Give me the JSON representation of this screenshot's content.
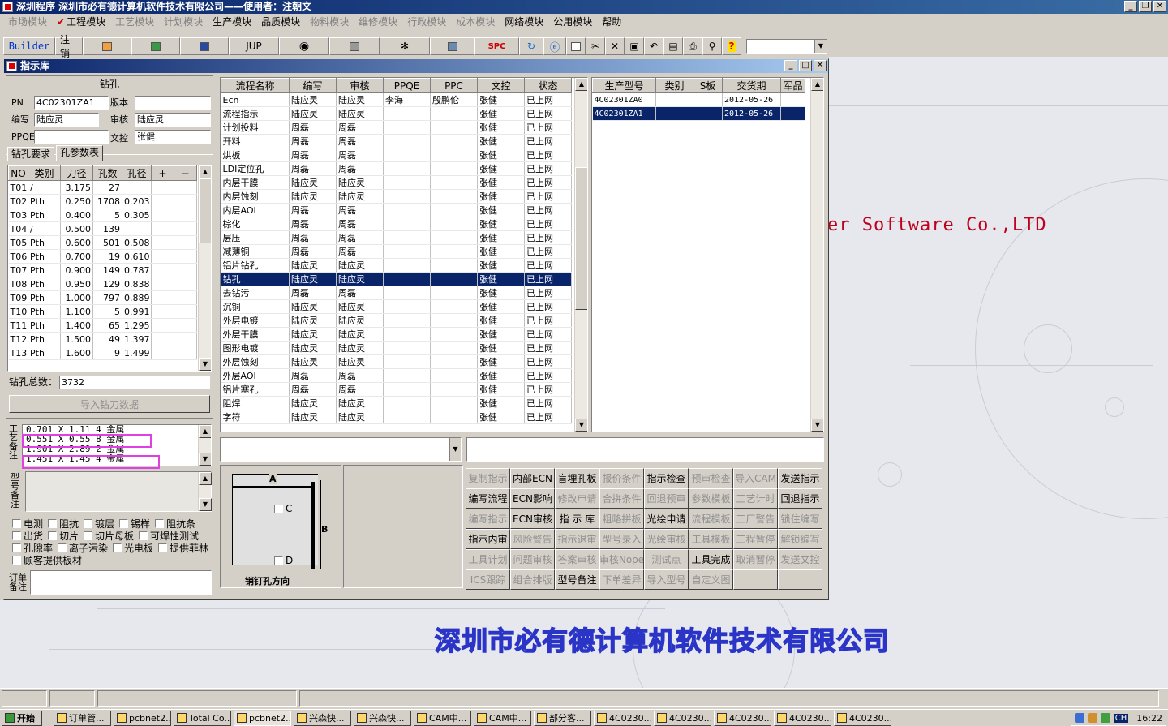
{
  "app": {
    "title": "深圳程序    深圳市必有德计算机软件技术有限公司——使用者：注朝文"
  },
  "menu": [
    {
      "label": "市场模块",
      "enabled": false
    },
    {
      "label": "工程模块",
      "enabled": true,
      "checked": true
    },
    {
      "label": "工艺模块",
      "enabled": false
    },
    {
      "label": "计划模块",
      "enabled": false
    },
    {
      "label": "生产模块",
      "enabled": true
    },
    {
      "label": "品质模块",
      "enabled": true
    },
    {
      "label": "物料模块",
      "enabled": false
    },
    {
      "label": "维修模块",
      "enabled": false
    },
    {
      "label": "行政模块",
      "enabled": false
    },
    {
      "label": "成本模块",
      "enabled": false
    },
    {
      "label": "网络模块",
      "enabled": true
    },
    {
      "label": "公用模块",
      "enabled": true
    },
    {
      "label": "帮助",
      "enabled": true
    }
  ],
  "toolbar": {
    "builder": "Builder",
    "logout": "注销",
    "jup": "JUP",
    "spc": "SPC"
  },
  "window": {
    "title": "指示库"
  },
  "drill": {
    "section_title": "钻孔",
    "pn_label": "PN",
    "pn_value": "4C02301ZA1",
    "version_label": "版本",
    "version_value": "",
    "writer_label": "编写",
    "writer_value": "陆应灵",
    "reviewer_label": "审核",
    "reviewer_value": "陆应灵",
    "ppqe_label": "PPQE",
    "ppqe_value": "",
    "doc_label": "文控",
    "doc_value": "张健",
    "tabs": [
      "钻孔要求",
      "孔参数表"
    ],
    "columns": [
      "NO",
      "类别",
      "刀径",
      "孔数",
      "孔径",
      "+",
      "−"
    ],
    "rows": [
      [
        "T01",
        "/",
        "3.175",
        "27",
        ""
      ],
      [
        "T02",
        "Pth",
        "0.250",
        "1708",
        "0.203"
      ],
      [
        "T03",
        "Pth",
        "0.400",
        "5",
        "0.305"
      ],
      [
        "T04",
        "/",
        "0.500",
        "139",
        ""
      ],
      [
        "T05",
        "Pth",
        "0.600",
        "501",
        "0.508"
      ],
      [
        "T06",
        "Pth",
        "0.700",
        "19",
        "0.610"
      ],
      [
        "T07",
        "Pth",
        "0.900",
        "149",
        "0.787"
      ],
      [
        "T08",
        "Pth",
        "0.950",
        "129",
        "0.838"
      ],
      [
        "T09",
        "Pth",
        "1.000",
        "797",
        "0.889"
      ],
      [
        "T10",
        "Pth",
        "1.100",
        "5",
        "0.991"
      ],
      [
        "T11",
        "Pth",
        "1.400",
        "65",
        "1.295"
      ],
      [
        "T12",
        "Pth",
        "1.500",
        "49",
        "1.397"
      ],
      [
        "T13",
        "Pth",
        "1.600",
        "9",
        "1.499"
      ]
    ],
    "total_label": "钻孔总数：",
    "total_value": "3732",
    "import_button": "导入钻刀数据",
    "process_notes_label": "工艺备注",
    "process_notes": [
      "0.701 X 1.11  4 金属",
      "0.551 X 0.55  8 金属",
      "1.901 X 2.89  2 金属",
      "1.451 X 1.45  4 金属"
    ],
    "model_notes_label": "型号备注",
    "checkboxes": [
      [
        "电测",
        "阻抗",
        "镀层",
        "锡样",
        "阻抗条"
      ],
      [
        "出货",
        "切片",
        "切片母板",
        "可焊性测试"
      ],
      [
        "孔隙率",
        "离子污染",
        "光电板",
        "提供菲林"
      ],
      [
        "顾客提供板材"
      ]
    ],
    "order_notes_label": "订单备注"
  },
  "flow": {
    "columns": [
      "流程名称",
      "编写",
      "审核",
      "PPQE",
      "PPC",
      "文控",
      "状态"
    ],
    "rows": [
      [
        "Ecn",
        "陆应灵",
        "陆应灵",
        "李海",
        "殷鹏伦",
        "张健",
        "已上网"
      ],
      [
        "流程指示",
        "陆应灵",
        "陆应灵",
        "",
        "",
        "张健",
        "已上网"
      ],
      [
        "计划投料",
        "周磊",
        "周磊",
        "",
        "",
        "张健",
        "已上网"
      ],
      [
        "开料",
        "周磊",
        "周磊",
        "",
        "",
        "张健",
        "已上网"
      ],
      [
        "烘板",
        "周磊",
        "周磊",
        "",
        "",
        "张健",
        "已上网"
      ],
      [
        "LDI定位孔",
        "周磊",
        "周磊",
        "",
        "",
        "张健",
        "已上网"
      ],
      [
        "内层干膜",
        "陆应灵",
        "陆应灵",
        "",
        "",
        "张健",
        "已上网"
      ],
      [
        "内层蚀刻",
        "陆应灵",
        "陆应灵",
        "",
        "",
        "张健",
        "已上网"
      ],
      [
        "内层AOI",
        "周磊",
        "周磊",
        "",
        "",
        "张健",
        "已上网"
      ],
      [
        "棕化",
        "周磊",
        "周磊",
        "",
        "",
        "张健",
        "已上网"
      ],
      [
        "层压",
        "周磊",
        "周磊",
        "",
        "",
        "张健",
        "已上网"
      ],
      [
        "减薄铜",
        "周磊",
        "周磊",
        "",
        "",
        "张健",
        "已上网"
      ],
      [
        "铝片钻孔",
        "陆应灵",
        "陆应灵",
        "",
        "",
        "张健",
        "已上网"
      ],
      [
        "钻孔",
        "陆应灵",
        "陆应灵",
        "",
        "",
        "张健",
        "已上网"
      ],
      [
        "去钻污",
        "周磊",
        "周磊",
        "",
        "",
        "张健",
        "已上网"
      ],
      [
        "沉铜",
        "陆应灵",
        "陆应灵",
        "",
        "",
        "张健",
        "已上网"
      ],
      [
        "外层电镀",
        "陆应灵",
        "陆应灵",
        "",
        "",
        "张健",
        "已上网"
      ],
      [
        "外层干膜",
        "陆应灵",
        "陆应灵",
        "",
        "",
        "张健",
        "已上网"
      ],
      [
        "图形电镀",
        "陆应灵",
        "陆应灵",
        "",
        "",
        "张健",
        "已上网"
      ],
      [
        "外层蚀刻",
        "陆应灵",
        "陆应灵",
        "",
        "",
        "张健",
        "已上网"
      ],
      [
        "外层AOI",
        "周磊",
        "周磊",
        "",
        "",
        "张健",
        "已上网"
      ],
      [
        "铝片塞孔",
        "周磊",
        "周磊",
        "",
        "",
        "张健",
        "已上网"
      ],
      [
        "阻焊",
        "陆应灵",
        "陆应灵",
        "",
        "",
        "张健",
        "已上网"
      ],
      [
        "字符",
        "陆应灵",
        "陆应灵",
        "",
        "",
        "张健",
        "已上网"
      ]
    ],
    "selected_index": 13
  },
  "models": {
    "columns": [
      "生产型号",
      "类别",
      "S板",
      "交货期",
      "军品"
    ],
    "rows": [
      [
        "4C02301ZA0",
        "",
        "",
        "2012-05-26",
        ""
      ],
      [
        "4C02301ZA1",
        "",
        "",
        "2012-05-26",
        ""
      ]
    ],
    "selected_index": 1
  },
  "diagram": {
    "label_a": "A",
    "label_b": "B",
    "label_c": "C",
    "label_d": "D",
    "caption": "销钉孔方向"
  },
  "actions": [
    {
      "label": "复制指示",
      "enabled": false
    },
    {
      "label": "内部ECN",
      "enabled": true
    },
    {
      "label": "盲埋孔板",
      "enabled": true
    },
    {
      "label": "报价条件",
      "enabled": false
    },
    {
      "label": "指示检查",
      "enabled": true
    },
    {
      "label": "预审检查",
      "enabled": false
    },
    {
      "label": "导入CAM",
      "enabled": false
    },
    {
      "label": "发送指示",
      "enabled": true
    },
    {
      "label": "编写流程",
      "enabled": true
    },
    {
      "label": "ECN影响",
      "enabled": true
    },
    {
      "label": "修改申请",
      "enabled": false
    },
    {
      "label": "合拼条件",
      "enabled": false
    },
    {
      "label": "回退预审",
      "enabled": false
    },
    {
      "label": "参数模板",
      "enabled": false
    },
    {
      "label": "工艺计时",
      "enabled": false
    },
    {
      "label": "回退指示",
      "enabled": true
    },
    {
      "label": "编写指示",
      "enabled": false
    },
    {
      "label": "ECN审核",
      "enabled": true
    },
    {
      "label": "指 示 库",
      "enabled": true
    },
    {
      "label": "粗略拼板",
      "enabled": false
    },
    {
      "label": "光绘申请",
      "enabled": true
    },
    {
      "label": "流程模板",
      "enabled": false
    },
    {
      "label": "工厂警告",
      "enabled": false
    },
    {
      "label": "锁住编写",
      "enabled": false
    },
    {
      "label": "指示内审",
      "enabled": true
    },
    {
      "label": "风险警告",
      "enabled": false
    },
    {
      "label": "指示退审",
      "enabled": false
    },
    {
      "label": "型号录入",
      "enabled": false
    },
    {
      "label": "光绘审核",
      "enabled": false
    },
    {
      "label": "工具模板",
      "enabled": false
    },
    {
      "label": "工程暂停",
      "enabled": false
    },
    {
      "label": "解锁编写",
      "enabled": false
    },
    {
      "label": "工具计划",
      "enabled": false
    },
    {
      "label": "问题审核",
      "enabled": false
    },
    {
      "label": "答案审核",
      "enabled": false
    },
    {
      "label": "审核Nope",
      "enabled": false
    },
    {
      "label": "测试点",
      "enabled": false
    },
    {
      "label": "工具完成",
      "enabled": true
    },
    {
      "label": "取消暂停",
      "enabled": false
    },
    {
      "label": "发送文控",
      "enabled": false
    },
    {
      "label": "ICS跟踪",
      "enabled": false
    },
    {
      "label": "组合排版",
      "enabled": false
    },
    {
      "label": "型号备注",
      "enabled": true
    },
    {
      "label": "下单差异",
      "enabled": false
    },
    {
      "label": "导入型号",
      "enabled": false
    },
    {
      "label": "自定义图",
      "enabled": false
    },
    {
      "label": "",
      "enabled": false
    },
    {
      "label": "",
      "enabled": false
    }
  ],
  "brand": {
    "english": "er Software Co.,LTD",
    "chinese": "深圳市必有德计算机软件技术有限公司"
  },
  "taskbar": {
    "start": "开始",
    "items": [
      "订单管...",
      "pcbnet2...",
      "Total Co...",
      "pcbnet2...",
      "兴森快...",
      "兴森快...",
      "CAM中...",
      "CAM中...",
      "部分客...",
      "4C0230...",
      "4C0230...",
      "4C0230...",
      "4C0230...",
      "4C0230..."
    ],
    "active_index": 3,
    "lang": "CH",
    "clock": "16:22"
  },
  "colors": {
    "selection": "#0a246a",
    "brand_red": "#c0001c",
    "brand_blue": "#2a35c8",
    "highlight_box": "#e040e0"
  }
}
